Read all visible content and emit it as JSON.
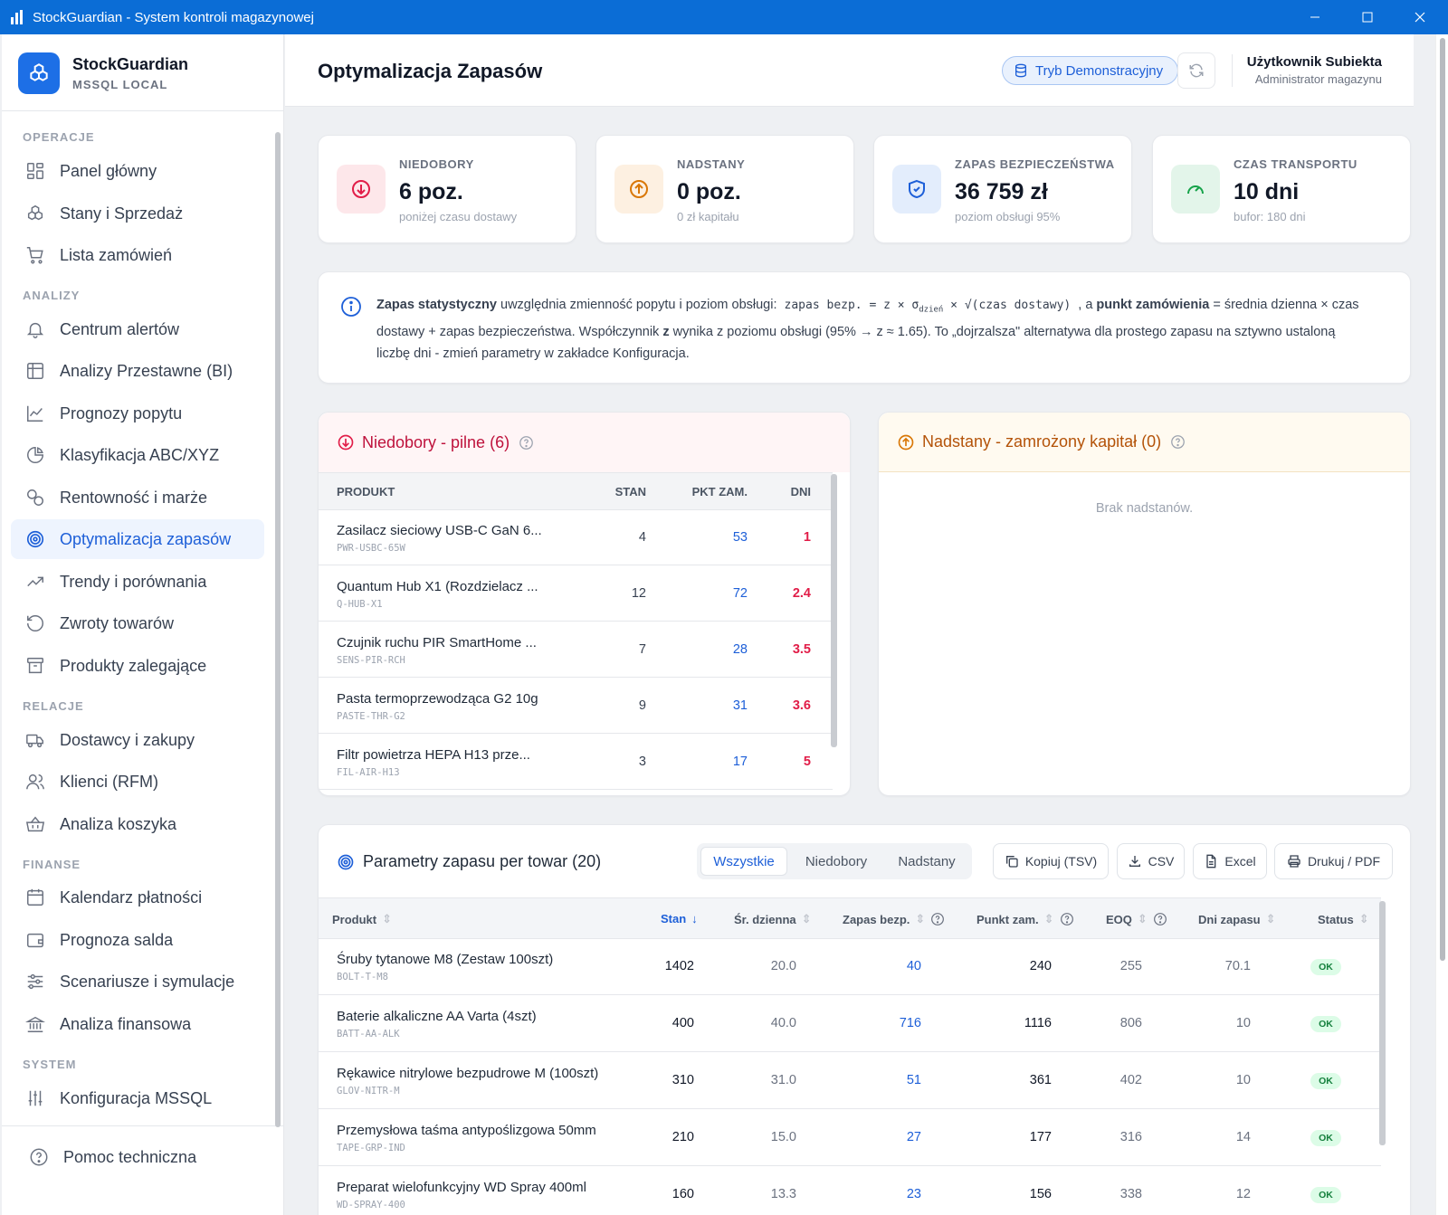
{
  "window": {
    "title": "StockGuardian - System kontroli magazynowej"
  },
  "brand": {
    "name": "StockGuardian",
    "sub": "MSSQL LOCAL"
  },
  "nav": {
    "sections": {
      "operacje": "OPERACJE",
      "analizy": "ANALIZY",
      "relacje": "RELACJE",
      "finanse": "FINANSE",
      "system": "SYSTEM"
    },
    "items": [
      {
        "label": "Panel główny",
        "icon": "grid-icon"
      },
      {
        "label": "Stany i Sprzedaż",
        "icon": "boxes-icon"
      },
      {
        "label": "Lista zamówień",
        "icon": "cart-icon"
      },
      {
        "label": "Centrum alertów",
        "icon": "bell-icon"
      },
      {
        "label": "Analizy Przestawne (BI)",
        "icon": "table-icon"
      },
      {
        "label": "Prognozy popytu",
        "icon": "line-chart-icon"
      },
      {
        "label": "Klasyfikacja ABC/XYZ",
        "icon": "pie-icon"
      },
      {
        "label": "Rentowność i marże",
        "icon": "coins-icon"
      },
      {
        "label": "Optymalizacja zapasów",
        "icon": "target-icon"
      },
      {
        "label": "Trendy i porównania",
        "icon": "trend-icon"
      },
      {
        "label": "Zwroty towarów",
        "icon": "undo-icon"
      },
      {
        "label": "Produkty zalegające",
        "icon": "archive-icon"
      },
      {
        "label": "Dostawcy i zakupy",
        "icon": "truck-icon"
      },
      {
        "label": "Klienci (RFM)",
        "icon": "users-icon"
      },
      {
        "label": "Analiza koszyka",
        "icon": "basket-icon"
      },
      {
        "label": "Kalendarz płatności",
        "icon": "calendar-icon"
      },
      {
        "label": "Prognoza salda",
        "icon": "wallet-icon"
      },
      {
        "label": "Scenariusze i symulacje",
        "icon": "sliders-icon"
      },
      {
        "label": "Analiza finansowa",
        "icon": "bank-icon"
      },
      {
        "label": "Konfiguracja MSSQL",
        "icon": "settings-sliders-icon"
      }
    ],
    "help": "Pomoc techniczna"
  },
  "header": {
    "title": "Optymalizacja Zapasów",
    "demo_mode": "Tryb Demonstracyjny",
    "user_name": "Użytkownik Subiekta",
    "user_role": "Administrator magazynu"
  },
  "kpis": [
    {
      "label": "NIEDOBORY",
      "value": "6 poz.",
      "sub": "poniżej czasu dostawy",
      "icon": "arrow-down-circle-icon",
      "color": "#e11d48"
    },
    {
      "label": "NADSTANY",
      "value": "0 poz.",
      "sub": "0 zł kapitału",
      "icon": "arrow-up-circle-icon",
      "color": "#d97706"
    },
    {
      "label": "ZAPAS BEZPIECZEŃSTWA",
      "value": "36 759 zł",
      "sub": "poziom obsługi 95%",
      "icon": "shield-icon",
      "color": "#1d5fd8"
    },
    {
      "label": "CZAS TRANSPORTU",
      "value": "10 dni",
      "sub": "bufor: 180 dni",
      "icon": "gauge-icon",
      "color": "#16a34a"
    }
  ],
  "info": {
    "b1": "Zapas statystyczny",
    "t1": " uwzględnia zmienność popytu i poziom obsługi: ",
    "formula": "zapas bezp. = z × σ",
    "formula_sub": "dzień",
    "formula_end": " × √(czas dostawy)",
    "t2": " , a ",
    "b2": "punkt zamówienia",
    "t3": " = średnia dzienna × czas dostawy + zapas bezpieczeństwa. Współczynnik ",
    "b3": "z",
    "t4": " wynika z poziomu obsługi (95% → z ≈ 1.65). To „dojrzalsza\" alternatywa dla prostego zapasu na sztywno ustaloną liczbę dni - zmień parametry w zakładce Konfiguracja."
  },
  "shortages": {
    "title": "Niedobory - pilne (6)",
    "columns": {
      "product": "PRODUKT",
      "stan": "STAN",
      "pkt": "PKT ZAM.",
      "dni": "DNI"
    },
    "rows": [
      {
        "name": "Zasilacz sieciowy USB-C GaN 6...",
        "sku": "PWR-USBC-65W",
        "stan": "4",
        "pkt": "53",
        "dni": "1"
      },
      {
        "name": "Quantum Hub X1 (Rozdzielacz ...",
        "sku": "Q-HUB-X1",
        "stan": "12",
        "pkt": "72",
        "dni": "2.4"
      },
      {
        "name": "Czujnik ruchu PIR SmartHome ...",
        "sku": "SENS-PIR-RCH",
        "stan": "7",
        "pkt": "28",
        "dni": "3.5"
      },
      {
        "name": "Pasta termoprzewodząca G2 10g",
        "sku": "PASTE-THR-G2",
        "stan": "9",
        "pkt": "31",
        "dni": "3.6"
      },
      {
        "name": "Filtr powietrza HEPA H13 prze...",
        "sku": "FIL-AIR-H13",
        "stan": "3",
        "pkt": "17",
        "dni": "5"
      }
    ]
  },
  "overstock": {
    "title": "Nadstany - zamrożony kapitał (0)",
    "empty": "Brak nadstanów."
  },
  "params": {
    "title": "Parametry zapasu per towar (20)",
    "filters": [
      "Wszystkie",
      "Niedobory",
      "Nadstany"
    ],
    "buttons": {
      "copy": "Kopiuj (TSV)",
      "csv": "CSV",
      "excel": "Excel",
      "print": "Drukuj / PDF"
    },
    "columns": {
      "product": "Produkt",
      "stan": "Stan",
      "avg": "Śr. dzienna",
      "safety": "Zapas bezp.",
      "reorder": "Punkt zam.",
      "eoq": "EOQ",
      "days": "Dni zapasu",
      "status": "Status"
    },
    "rows": [
      {
        "name": "Śruby tytanowe M8 (Zestaw 100szt)",
        "sku": "BOLT-T-M8",
        "stan": "1402",
        "avg": "20.0",
        "safety": "40",
        "reorder": "240",
        "eoq": "255",
        "days": "70.1",
        "status": "OK"
      },
      {
        "name": "Baterie alkaliczne AA Varta (4szt)",
        "sku": "BATT-AA-ALK",
        "stan": "400",
        "avg": "40.0",
        "safety": "716",
        "reorder": "1116",
        "eoq": "806",
        "days": "10",
        "status": "OK"
      },
      {
        "name": "Rękawice nitrylowe bezpudrowe M (100szt)",
        "sku": "GLOV-NITR-M",
        "stan": "310",
        "avg": "31.0",
        "safety": "51",
        "reorder": "361",
        "eoq": "402",
        "days": "10",
        "status": "OK"
      },
      {
        "name": "Przemysłowa taśma antypoślizgowa 50mm",
        "sku": "TAPE-GRP-IND",
        "stan": "210",
        "avg": "15.0",
        "safety": "27",
        "reorder": "177",
        "eoq": "316",
        "days": "14",
        "status": "OK"
      },
      {
        "name": "Preparat wielofunkcyjny WD Spray 400ml",
        "sku": "WD-SPRAY-400",
        "stan": "160",
        "avg": "13.3",
        "safety": "23",
        "reorder": "156",
        "eoq": "338",
        "days": "12",
        "status": "OK"
      }
    ]
  }
}
